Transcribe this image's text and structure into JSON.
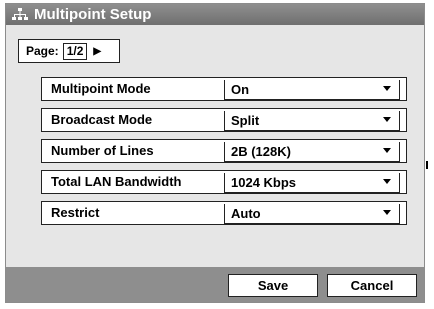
{
  "window": {
    "title": "Multipoint Setup",
    "icon": "network-icon"
  },
  "pager": {
    "label": "Page:",
    "value": "1/2",
    "next_icon": "triangle-right-icon"
  },
  "settings": [
    {
      "label": "Multipoint Mode",
      "value": "On"
    },
    {
      "label": "Broadcast Mode",
      "value": "Split"
    },
    {
      "label": "Number of Lines",
      "value": "2B (128K)"
    },
    {
      "label": "Total LAN Bandwidth",
      "value": "1024 Kbps"
    },
    {
      "label": "Restrict",
      "value": "Auto"
    }
  ],
  "buttons": {
    "save": "Save",
    "cancel": "Cancel"
  },
  "colors": {
    "titlebar": "#7f7f7f",
    "panel": "#e6e6e6",
    "footer": "#8e8e8e"
  }
}
